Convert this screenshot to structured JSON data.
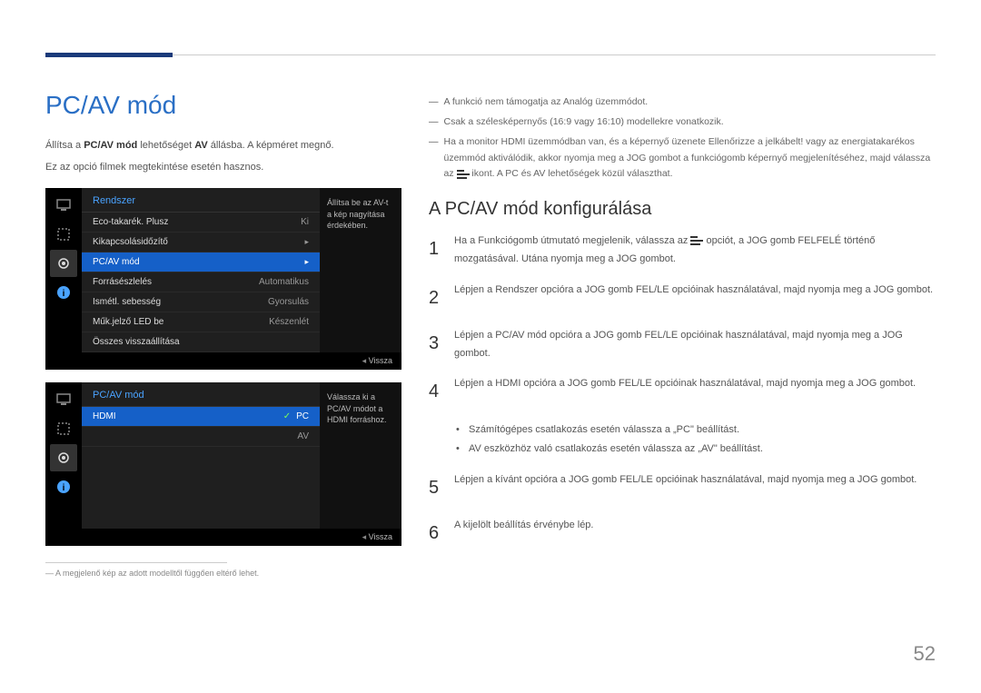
{
  "page_number": "52",
  "left": {
    "title": "PC/AV mód",
    "p1_a": "Állítsa a ",
    "p1_b": "PC/AV mód",
    "p1_c": " lehetőséget ",
    "p1_d": "AV",
    "p1_e": " állásba. A képméret megnő.",
    "p2": "Ez az opció filmek megtekintése esetén hasznos.",
    "footnote": "A megjelenő kép az adott modelltől függően eltérő lehet."
  },
  "osd1": {
    "title": "Rendszer",
    "desc": "Állítsa be az AV-t a kép nagyítása érdekében.",
    "rows": [
      {
        "label": "Eco-takarék. Plusz",
        "value": "Ki"
      },
      {
        "label": "Kikapcsolásidőzítő",
        "value": "▸"
      },
      {
        "label": "PC/AV mód",
        "value": "▸",
        "selected": true
      },
      {
        "label": "Forrásészlelés",
        "value": "Automatikus"
      },
      {
        "label": "Ismétl. sebesség",
        "value": "Gyorsulás"
      },
      {
        "label": "Műk.jelző LED be",
        "value": "Készenlét"
      },
      {
        "label": "Összes visszaállítása",
        "value": ""
      }
    ],
    "footer": "Vissza"
  },
  "osd2": {
    "title": "PC/AV mód",
    "desc": "Válassza ki a PC/AV módot a HDMI forráshoz.",
    "row_label": "HDMI",
    "opt_pc": "PC",
    "opt_av": "AV",
    "footer": "Vissza"
  },
  "right": {
    "n1_a": "A funkció nem támogatja az ",
    "n1_b": "Analóg",
    "n1_c": " üzemmódot.",
    "n2": "Csak a szélesképernyős (16:9 vagy 16:10) modellekre vonatkozik.",
    "n3_a": "Ha a monitor ",
    "n3_b": "HDMI",
    "n3_c": " üzemmódban van, és a képernyő üzenete ",
    "n3_d": "Ellenőrizze a jelkábelt!",
    "n3_e": " vagy az energiatakarékos üzemmód aktiválódik, akkor nyomja meg a JOG gombot a funkciógomb képernyő megjelenítéséhez, majd válassza az ",
    "n3_f": " ikont. A ",
    "n3_g": "PC",
    "n3_h": " és ",
    "n3_i": "AV",
    "n3_j": " lehetőségek közül választhat.",
    "subhead": "A PC/AV mód konfigurálása",
    "s1_a": "Ha a Funkciógomb útmutató megjelenik, válassza az ",
    "s1_b": " opciót, a JOG gomb FELFELÉ történő mozgatásával. Utána nyomja meg a JOG gombot.",
    "s2_a": "Lépjen a ",
    "s2_b": "Rendszer",
    "s2_c": " opcióra a JOG gomb FEL/LE opcióinak használatával, majd nyomja meg a JOG gombot.",
    "s3_a": "Lépjen a ",
    "s3_b": "PC/AV mód",
    "s3_c": " opcióra a JOG gomb FEL/LE opcióinak használatával, majd nyomja meg a JOG gombot.",
    "s4_a": "Lépjen a ",
    "s4_b": "HDMI",
    "s4_c": " opcióra a JOG gomb FEL/LE opcióinak használatával, majd nyomja meg a JOG gombot.",
    "b1": "Számítógépes csatlakozás esetén válassza a „PC\" beállítást.",
    "b2": "AV eszközhöz való csatlakozás esetén válassza az „AV\" beállítást.",
    "s5": "Lépjen a kívánt opcióra a JOG gomb FEL/LE opcióinak használatával, majd nyomja meg a JOG gombot.",
    "s6": "A kijelölt beállítás érvénybe lép."
  }
}
